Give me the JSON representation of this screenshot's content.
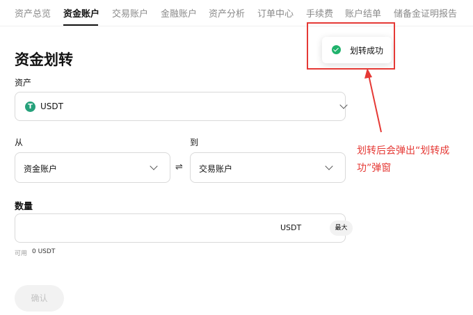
{
  "nav": {
    "tabs": [
      {
        "label": "资产总览",
        "active": false
      },
      {
        "label": "资金账户",
        "active": true
      },
      {
        "label": "交易账户",
        "active": false
      },
      {
        "label": "金融账户",
        "active": false
      },
      {
        "label": "资产分析",
        "active": false
      },
      {
        "label": "订单中心",
        "active": false
      },
      {
        "label": "手续费",
        "active": false
      },
      {
        "label": "账户结单",
        "active": false
      },
      {
        "label": "储备金证明报告",
        "active": false
      }
    ]
  },
  "transfer": {
    "title": "资金划转",
    "asset_label": "资产",
    "asset_value": "USDT",
    "asset_icon": "usdt-coin-icon",
    "asset_icon_glyph": "T",
    "from_label": "从",
    "from_value": "资金账户",
    "to_label": "到",
    "to_value": "交易账户",
    "swap_glyph": "⇌",
    "amount_label": "数量",
    "amount_value": "",
    "amount_unit": "USDT",
    "max_label": "最大",
    "available_label": "可用",
    "available_value": "0 USDT",
    "confirm_label": "确认"
  },
  "toast": {
    "icon": "success-check-icon",
    "text": "划转成功"
  },
  "annotation": {
    "text": "划转后会弹出“划转成功”弹窗",
    "color": "#e53935"
  },
  "colors": {
    "accent_text": "#121212",
    "success": "#20b26c",
    "usdt_green": "#26a17b",
    "annotation_red": "#e53935"
  }
}
